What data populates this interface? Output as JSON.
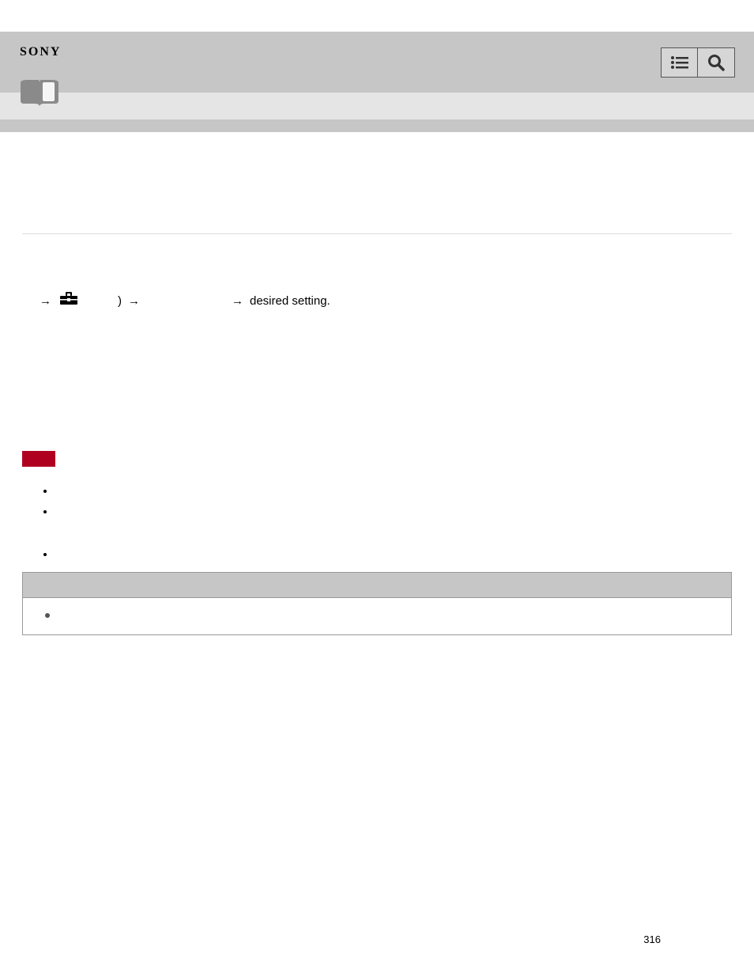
{
  "logo": "SONY",
  "nav_suffix": " desired setting.",
  "paren": ")",
  "page_number": "316"
}
